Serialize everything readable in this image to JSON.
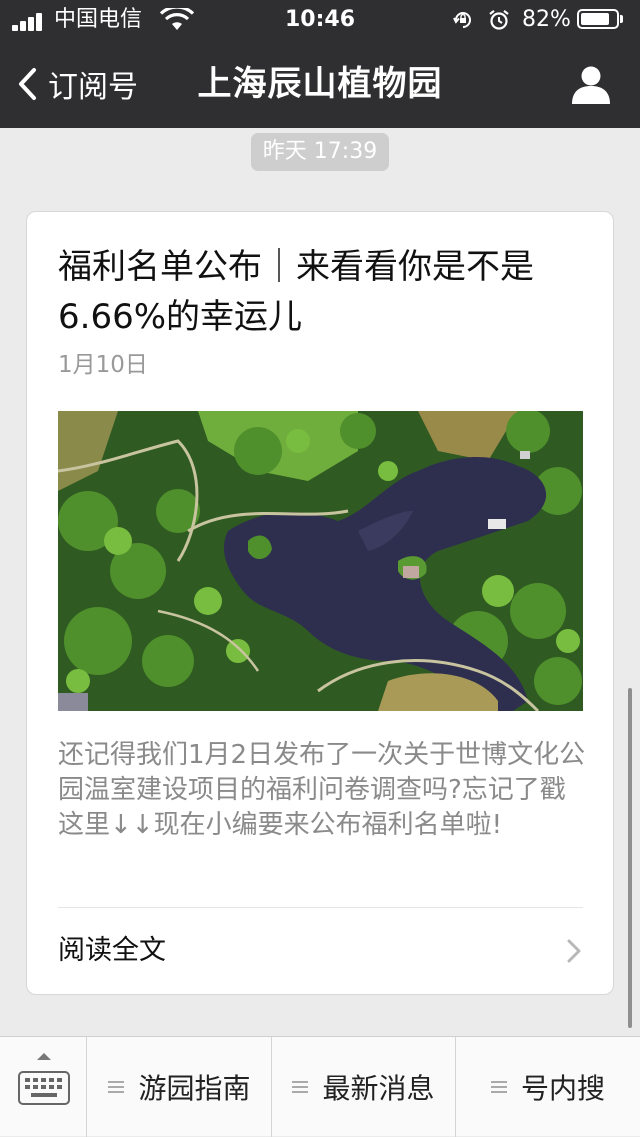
{
  "status_bar": {
    "carrier": "中国电信",
    "time": "10:46",
    "battery_percent": "82%",
    "battery_level": 0.82,
    "icons": [
      "signal-icon",
      "wifi-icon",
      "rotation-lock-icon",
      "alarm-icon",
      "battery-icon"
    ]
  },
  "nav": {
    "back_label": "订阅号",
    "title": "上海辰山植物园",
    "back_icon": "chevron-left-icon",
    "profile_icon": "person-icon"
  },
  "chat": {
    "timestamp": "昨天 17:39"
  },
  "article": {
    "title": "福利名单公布｜来看看你是不是6.66%的幸运儿",
    "date": "1月10日",
    "summary": "还记得我们1月2日发布了一次关于世博文化公园温室建设项目的福利问卷调查吗?忘记了戳这里↓↓现在小编要来公布福利名单啦!",
    "read_more": "阅读全文",
    "read_more_icon": "chevron-right-icon"
  },
  "bottom_menu": {
    "keyboard_icon": "keyboard-icon",
    "items": [
      {
        "label": "游园指南",
        "icon": "menu-lines-icon"
      },
      {
        "label": "最新消息",
        "icon": "menu-lines-icon"
      },
      {
        "label": "号内搜",
        "icon": "menu-lines-icon"
      }
    ]
  },
  "colors": {
    "nav_bg": "#2f2f31",
    "page_bg": "#ebebeb",
    "card_bg": "#ffffff",
    "muted_text": "#999999"
  }
}
